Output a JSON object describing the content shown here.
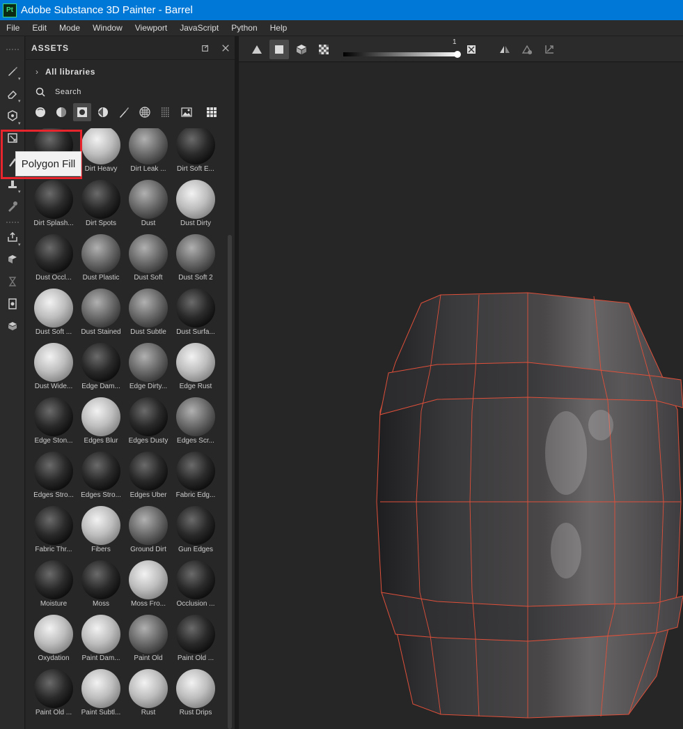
{
  "window": {
    "app_icon": "Pt",
    "title": "Adobe Substance 3D Painter - Barrel"
  },
  "menu": [
    "File",
    "Edit",
    "Mode",
    "Window",
    "Viewport",
    "JavaScript",
    "Python",
    "Help"
  ],
  "tooltip": "Polygon Fill",
  "assets": {
    "title": "ASSETS",
    "libraries_label": "All libraries",
    "search_placeholder": "Search",
    "filter_icons": [
      "material-sphere-icon",
      "smart-material-icon",
      "mask-icon",
      "generator-icon",
      "brush-icon",
      "texture-icon",
      "alpha-icon",
      "environment-icon",
      "grid-view-icon"
    ],
    "active_filter": 2,
    "items": [
      {
        "label": "",
        "tone": "dark"
      },
      {
        "label": "Dirt Heavy",
        "tone": "light"
      },
      {
        "label": "Dirt Leak ...",
        "tone": "mid"
      },
      {
        "label": "Dirt Soft E...",
        "tone": "dark"
      },
      {
        "label": "Dirt Splash...",
        "tone": "dark"
      },
      {
        "label": "Dirt Spots",
        "tone": "dark"
      },
      {
        "label": "Dust",
        "tone": "mid"
      },
      {
        "label": "Dust Dirty",
        "tone": "light"
      },
      {
        "label": "Dust Occl...",
        "tone": "dark"
      },
      {
        "label": "Dust Plastic",
        "tone": "mid"
      },
      {
        "label": "Dust Soft",
        "tone": "mid"
      },
      {
        "label": "Dust Soft 2",
        "tone": "mid"
      },
      {
        "label": "Dust Soft ...",
        "tone": "light"
      },
      {
        "label": "Dust Stained",
        "tone": "mid"
      },
      {
        "label": "Dust Subtle",
        "tone": "mid"
      },
      {
        "label": "Dust Surfa...",
        "tone": "dark"
      },
      {
        "label": "Dust Wide...",
        "tone": "light"
      },
      {
        "label": "Edge Dam...",
        "tone": "dark"
      },
      {
        "label": "Edge Dirty...",
        "tone": "mid"
      },
      {
        "label": "Edge Rust",
        "tone": "light"
      },
      {
        "label": "Edge Ston...",
        "tone": "dark"
      },
      {
        "label": "Edges Blur",
        "tone": "light"
      },
      {
        "label": "Edges Dusty",
        "tone": "dark"
      },
      {
        "label": "Edges Scr...",
        "tone": "mid"
      },
      {
        "label": "Edges Stro...",
        "tone": "dark"
      },
      {
        "label": "Edges Stro...",
        "tone": "dark"
      },
      {
        "label": "Edges Uber",
        "tone": "dark"
      },
      {
        "label": "Fabric Edg...",
        "tone": "dark"
      },
      {
        "label": "Fabric Thr...",
        "tone": "dark"
      },
      {
        "label": "Fibers",
        "tone": "light"
      },
      {
        "label": "Ground Dirt",
        "tone": "mid"
      },
      {
        "label": "Gun Edges",
        "tone": "dark"
      },
      {
        "label": "Moisture",
        "tone": "dark"
      },
      {
        "label": "Moss",
        "tone": "dark"
      },
      {
        "label": "Moss Fro...",
        "tone": "light"
      },
      {
        "label": "Occlusion ...",
        "tone": "dark"
      },
      {
        "label": "Oxydation",
        "tone": "light"
      },
      {
        "label": "Paint Dam...",
        "tone": "light"
      },
      {
        "label": "Paint Old",
        "tone": "mid"
      },
      {
        "label": "Paint Old ...",
        "tone": "dark"
      },
      {
        "label": "Paint Old ...",
        "tone": "dark"
      },
      {
        "label": "Paint Subtl...",
        "tone": "light"
      },
      {
        "label": "Rust",
        "tone": "light"
      },
      {
        "label": "Rust Drips",
        "tone": "light"
      }
    ]
  },
  "viewport": {
    "slider_value": "1",
    "wireframe_color": "#e0503a"
  }
}
